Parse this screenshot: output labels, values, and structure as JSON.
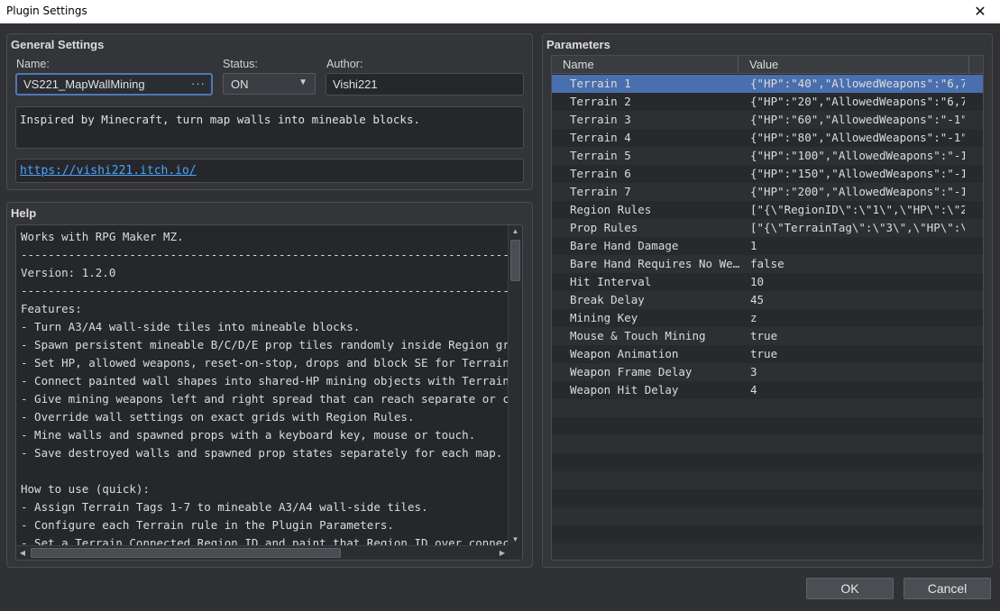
{
  "window": {
    "title": "Plugin Settings"
  },
  "general": {
    "title": "General Settings",
    "name_label": "Name:",
    "name_value": "VS221_MapWallMining",
    "status_label": "Status:",
    "status_value": "ON",
    "author_label": "Author:",
    "author_value": "Vishi221",
    "description": "Inspired by Minecraft, turn map walls into mineable blocks.",
    "url": "https://vishi221.itch.io/"
  },
  "help": {
    "title": "Help",
    "lines": [
      "Works with RPG Maker MZ.",
      "------------------------------------------------------------------------",
      "Version: 1.2.0",
      "------------------------------------------------------------------------",
      "Features:",
      "- Turn A3/A4 wall-side tiles into mineable blocks.",
      "- Spawn persistent mineable B/C/D/E prop tiles randomly inside Region grids.",
      "- Set HP, allowed weapons, reset-on-stop, drops and block SE for Terrain, Region",
      "- Connect painted wall shapes into shared-HP mining objects with Terrain or Region",
      "- Give mining weapons left and right spread that can reach separate or connected",
      "- Override wall settings on exact grids with Region Rules.",
      "- Mine walls and spawned props with a keyboard key, mouse or touch.",
      "- Save destroyed walls and spawned prop states separately for each map.",
      "",
      "How to use (quick):",
      "- Assign Terrain Tags 1-7 to mineable A3/A4 wall-side tiles.",
      "- Configure each Terrain rule in the Plugin Parameters.",
      "- Set a Terrain Connected Region ID and paint that Region ID over connected walls"
    ]
  },
  "parameters": {
    "title": "Parameters",
    "col_name": "Name",
    "col_value": "Value",
    "rows": [
      {
        "name": "Terrain 1",
        "value": "{\"HP\":\"40\",\"AllowedWeapons\":\"6,7…"
      },
      {
        "name": "Terrain 2",
        "value": "{\"HP\":\"20\",\"AllowedWeapons\":\"6,7…"
      },
      {
        "name": "Terrain 3",
        "value": "{\"HP\":\"60\",\"AllowedWeapons\":\"-1\"…"
      },
      {
        "name": "Terrain 4",
        "value": "{\"HP\":\"80\",\"AllowedWeapons\":\"-1\"…"
      },
      {
        "name": "Terrain 5",
        "value": "{\"HP\":\"100\",\"AllowedWeapons\":\"-1…"
      },
      {
        "name": "Terrain 6",
        "value": "{\"HP\":\"150\",\"AllowedWeapons\":\"-1…"
      },
      {
        "name": "Terrain 7",
        "value": "{\"HP\":\"200\",\"AllowedWeapons\":\"-1…"
      },
      {
        "name": "Region Rules",
        "value": "[\"{\\\"RegionID\\\":\\\"1\\\",\\\"HP\\\":\\\"2…"
      },
      {
        "name": "Prop Rules",
        "value": "[\"{\\\"TerrainTag\\\":\\\"3\\\",\\\"HP\\\":\\…"
      },
      {
        "name": "Bare Hand Damage",
        "value": "1"
      },
      {
        "name": "Bare Hand Requires No We…",
        "value": "false"
      },
      {
        "name": "Hit Interval",
        "value": "10"
      },
      {
        "name": "Break Delay",
        "value": "45"
      },
      {
        "name": "Mining Key",
        "value": "z"
      },
      {
        "name": "Mouse & Touch Mining",
        "value": "true"
      },
      {
        "name": "Weapon Animation",
        "value": "true"
      },
      {
        "name": "Weapon Frame Delay",
        "value": "3"
      },
      {
        "name": "Weapon Hit Delay",
        "value": "4"
      }
    ]
  },
  "buttons": {
    "ok": "OK",
    "cancel": "Cancel"
  },
  "colors": {
    "accent": "#4a6fae",
    "link": "#4ea3ff",
    "background": "#2f3134"
  }
}
